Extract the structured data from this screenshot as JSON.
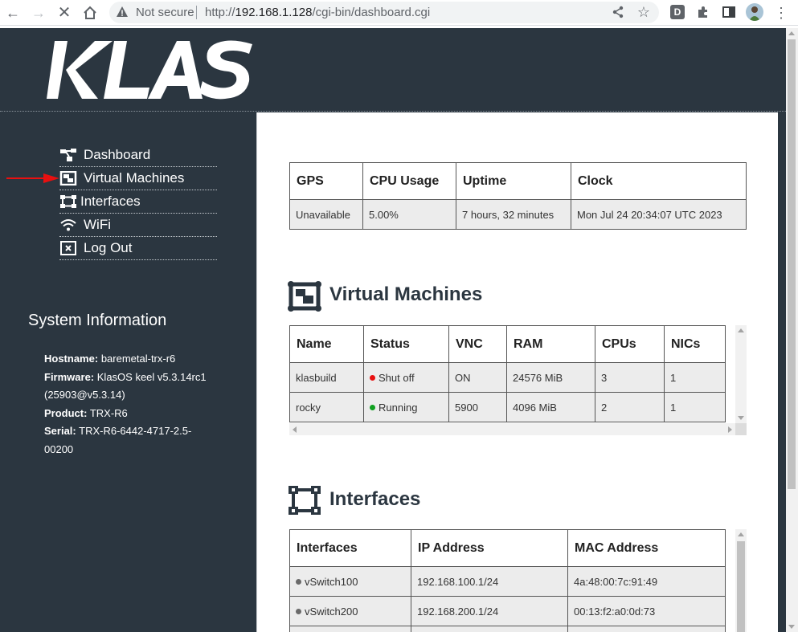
{
  "browser": {
    "security_label": "Not secure",
    "url_host": "192.168.1.128",
    "url_path": "/cgi-bin/dashboard.cgi",
    "url_scheme": "http://",
    "ext_badge": "D"
  },
  "logo": {
    "text": "KLAS"
  },
  "sidebar": {
    "items": [
      {
        "label": "Dashboard",
        "icon": "dashboard-icon"
      },
      {
        "label": "Virtual Machines",
        "icon": "virtual-machines-icon"
      },
      {
        "label": "Interfaces",
        "icon": "interfaces-icon"
      },
      {
        "label": "WiFi",
        "icon": "wifi-icon"
      },
      {
        "label": "Log Out",
        "icon": "logout-icon"
      }
    ]
  },
  "system_info": {
    "title": "System Information",
    "hostname_label": "Hostname:",
    "hostname": "baremetal-trx-r6",
    "firmware_label": "Firmware:",
    "firmware": "KlasOS keel v5.3.14rc1",
    "firmware_build": "(25903@v5.3.14)",
    "product_label": "Product:",
    "product": "TRX-R6",
    "serial_label": "Serial:",
    "serial": "TRX-R6-6442-4717-2.5-",
    "serial_cont": "00200"
  },
  "status": {
    "headers": [
      "GPS",
      "CPU Usage",
      "Uptime",
      "Clock"
    ],
    "values": [
      "Unavailable",
      "5.00%",
      "7 hours, 32 minutes",
      "Mon Jul 24 20:34:07 UTC 2023"
    ]
  },
  "vms": {
    "title": "Virtual Machines",
    "headers": [
      "Name",
      "Status",
      "VNC",
      "RAM",
      "CPUs",
      "NICs"
    ],
    "rows": [
      {
        "name": "klasbuild",
        "status": "Shut off",
        "status_color": "#e81010",
        "vnc": "ON",
        "ram": "24576 MiB",
        "cpus": "3",
        "nics": "1"
      },
      {
        "name": "rocky",
        "status": "Running",
        "status_color": "#10a020",
        "vnc": "5900",
        "ram": "4096 MiB",
        "cpus": "2",
        "nics": "1"
      }
    ]
  },
  "interfaces": {
    "title": "Interfaces",
    "headers": [
      "Interfaces",
      "IP Address",
      "MAC Address"
    ],
    "rows": [
      {
        "name": "vSwitch100",
        "ip": "192.168.100.1/24",
        "mac": "4a:48:00:7c:91:49"
      },
      {
        "name": "vSwitch200",
        "ip": "192.168.200.1/24",
        "mac": "00:13:f2:a0:0d:73"
      }
    ]
  },
  "colors": {
    "sidebar_bg": "#2b3640",
    "accent_red": "#e81010"
  }
}
